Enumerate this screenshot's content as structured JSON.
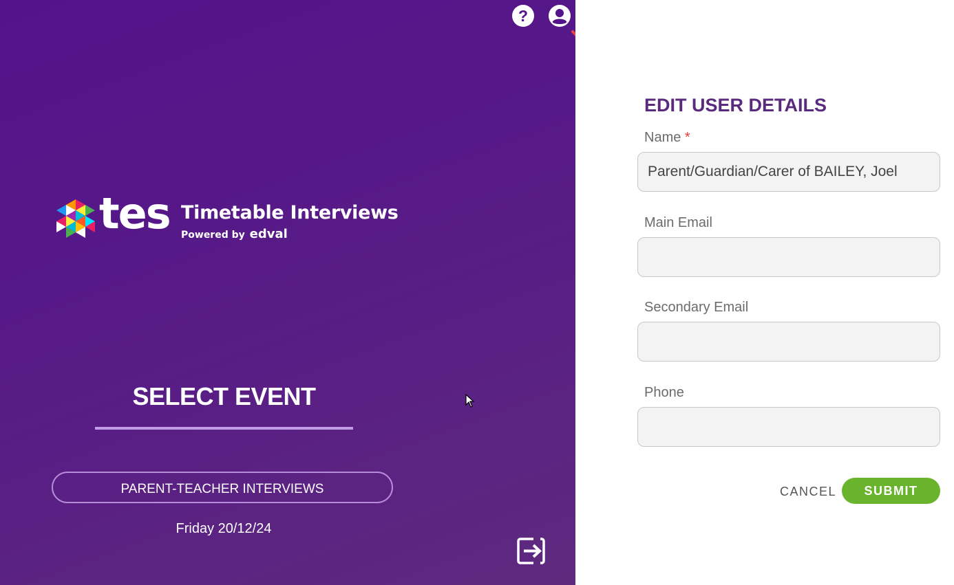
{
  "header": {
    "help_icon": "help-circle-icon",
    "account_icon": "account-circle-icon"
  },
  "brand": {
    "logo_word": "tes",
    "product_name": "Timetable Interviews",
    "powered_by": "Powered by",
    "powered_brand": "edval"
  },
  "event_panel": {
    "heading": "SELECT EVENT",
    "event_button_label": "PARENT-TEACHER INTERVIEWS",
    "event_date": "Friday 20/12/24",
    "logout_icon": "logout-icon"
  },
  "form": {
    "title": "EDIT USER DETAILS",
    "required_marker": "*",
    "fields": {
      "name": {
        "label": "Name",
        "value": "Parent/Guardian/Carer of BAILEY, Joel",
        "placeholder": ""
      },
      "main_email": {
        "label": "Main Email",
        "value": "",
        "placeholder": ""
      },
      "secondary_email": {
        "label": "Secondary Email",
        "value": "",
        "placeholder": ""
      },
      "phone": {
        "label": "Phone",
        "value": "",
        "placeholder": ""
      }
    },
    "cancel_label": "CANCEL",
    "submit_label": "SUBMIT"
  },
  "colors": {
    "panel_purple": "#53138a",
    "title_purple": "#5a2a7e",
    "submit_green": "#6ab42d",
    "underline_lilac": "#c49be6",
    "required_red": "#e53935",
    "annotation_red": "#e8453c"
  }
}
